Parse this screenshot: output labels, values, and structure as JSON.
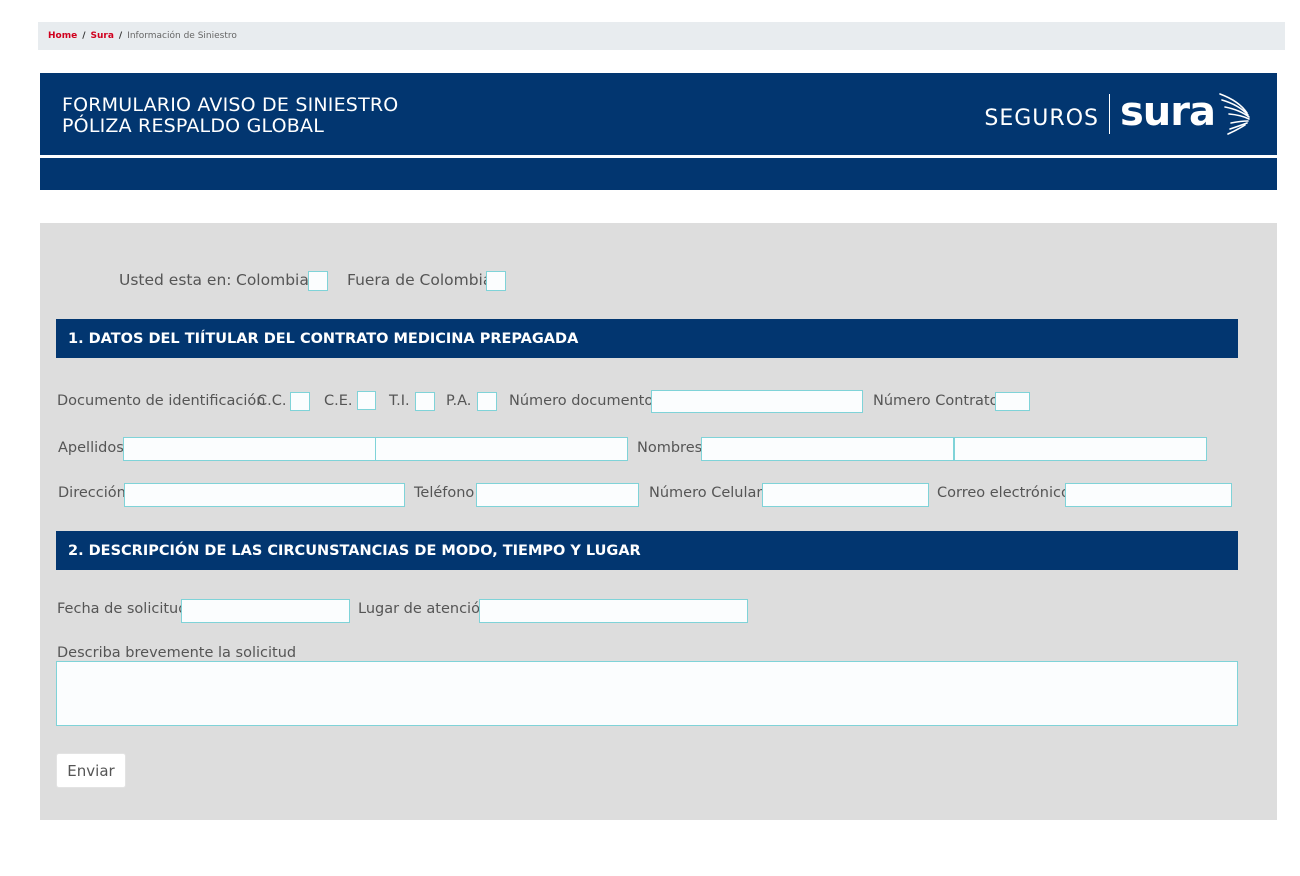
{
  "breadcrumb": {
    "home": "Home",
    "sura": "Sura",
    "current": "Información de Siniestro",
    "separator": "/"
  },
  "header": {
    "title_line1": "FORMULARIO AVISO DE SINIESTRO",
    "title_line2": "PÓLIZA RESPALDO GLOBAL",
    "brand_seguros": "SEGUROS",
    "brand_sura": "sura"
  },
  "location": {
    "label": "Usted esta en:",
    "option_colombia": "Colombia",
    "option_outside": "Fuera de Colombia"
  },
  "section1": {
    "title": "1. DATOS DEL TIÍTULAR DEL CONTRATO MEDICINA PREPAGADA",
    "doc_label": "Documento de identificación",
    "doc_cc": "C.C.",
    "doc_ce": "C.E.",
    "doc_ti": "T.I.",
    "doc_pa": "P.A.",
    "doc_number_label": "Número documento",
    "contract_label": "Número Contrato",
    "surnames_label": "Apellidos",
    "names_label": "Nombres",
    "address_label": "Dirección",
    "phone_label": "Teléfono",
    "mobile_label": "Número Celular",
    "email_label": "Correo electrónico"
  },
  "section2": {
    "title": "2. DESCRIPCIÓN DE LAS CIRCUNSTANCIAS DE MODO, TIEMPO Y LUGAR",
    "date_label": "Fecha de solicitud",
    "place_label": "Lugar de atención",
    "description_label": "Describa brevemente la solicitud"
  },
  "submit_label": "Enviar",
  "colors": {
    "navy": "#023670",
    "panel": "#dddddd",
    "link_red": "#d0001e",
    "input_border": "#7fd3d8"
  }
}
